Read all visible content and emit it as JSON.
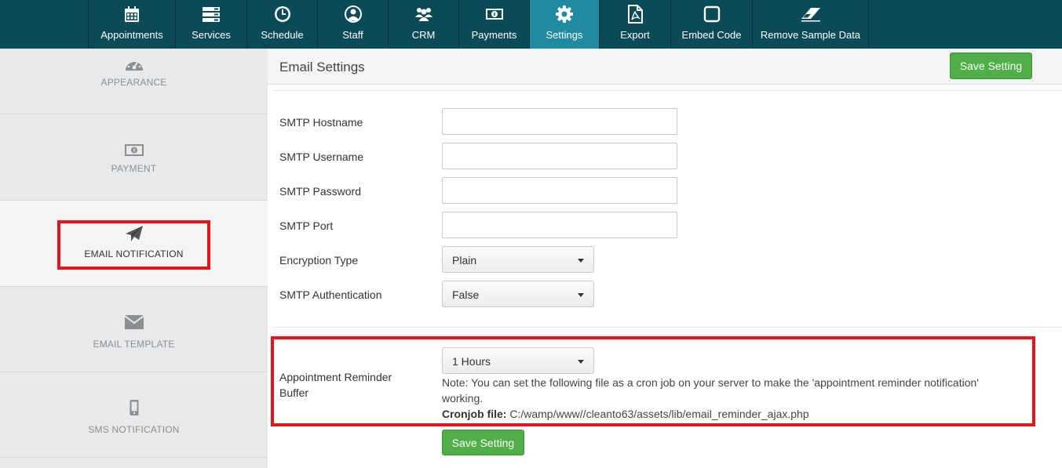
{
  "nav": {
    "items": [
      {
        "label": "Appointments",
        "icon": "calendar-icon"
      },
      {
        "label": "Services",
        "icon": "services-icon"
      },
      {
        "label": "Schedule",
        "icon": "clock-icon"
      },
      {
        "label": "Staff",
        "icon": "user-icon"
      },
      {
        "label": "CRM",
        "icon": "users-icon"
      },
      {
        "label": "Payments",
        "icon": "money-icon"
      },
      {
        "label": "Settings",
        "icon": "gear-icon"
      },
      {
        "label": "Export",
        "icon": "pdf-icon"
      },
      {
        "label": "Embed Code",
        "icon": "square-icon"
      },
      {
        "label": "Remove Sample Data",
        "icon": "eraser-icon"
      }
    ],
    "active": "Settings"
  },
  "sidebar": {
    "items": [
      {
        "label": "APPEARANCE",
        "icon": "dashboard-icon"
      },
      {
        "label": "PAYMENT",
        "icon": "money-icon"
      },
      {
        "label": "EMAIL NOTIFICATION",
        "icon": "paper-plane-icon"
      },
      {
        "label": "EMAIL TEMPLATE",
        "icon": "envelope-icon"
      },
      {
        "label": "SMS NOTIFICATION",
        "icon": "mobile-icon"
      }
    ],
    "active": "EMAIL NOTIFICATION"
  },
  "main": {
    "title": "Email Settings",
    "save_label": "Save Setting",
    "fields": {
      "smtp_hostname": {
        "label": "SMTP Hostname",
        "value": ""
      },
      "smtp_username": {
        "label": "SMTP Username",
        "value": ""
      },
      "smtp_password": {
        "label": "SMTP Password",
        "value": ""
      },
      "smtp_port": {
        "label": "SMTP Port",
        "value": ""
      },
      "encryption_type": {
        "label": "Encryption Type",
        "value": "Plain"
      },
      "smtp_authentication": {
        "label": "SMTP Authentication",
        "value": "False"
      }
    },
    "reminder": {
      "label_line1": "Appointment Reminder",
      "label_line2": "Buffer",
      "value": "1 Hours",
      "note_line1": "Note: You can set the following file as a cron job on your server to make the 'appointment reminder notification'",
      "note_line2": "working.",
      "cron_label": "Cronjob file:",
      "cron_path": "C:/wamp/www//cleanto63/assets/lib/email_reminder_ajax.php"
    },
    "bottom_save_label": "Save Setting"
  },
  "colors": {
    "nav_bg": "#0b4a57",
    "nav_active": "#1f8aa0",
    "save_green": "#4fae48",
    "highlight_red": "#e8141b"
  }
}
